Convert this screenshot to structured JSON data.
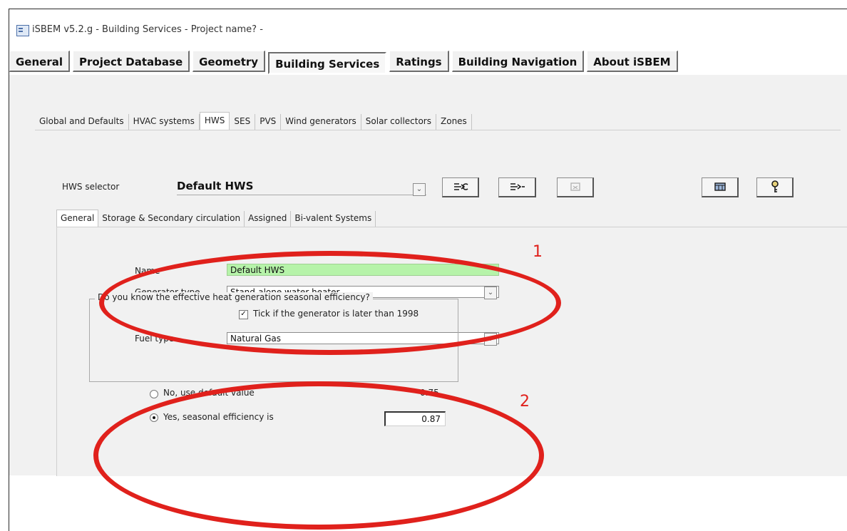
{
  "window": {
    "title": "iSBEM v5.2.g - Building Services - Project name? -"
  },
  "main_tabs": [
    {
      "label": "General"
    },
    {
      "label": "Project Database"
    },
    {
      "label": "Geometry"
    },
    {
      "label": "Building Services",
      "active": true
    },
    {
      "label": "Ratings"
    },
    {
      "label": "Building Navigation"
    },
    {
      "label": "About iSBEM"
    }
  ],
  "sub_tabs": [
    {
      "label": "Global and Defaults"
    },
    {
      "label": "HVAC systems"
    },
    {
      "label": "HWS",
      "active": true
    },
    {
      "label": "SES"
    },
    {
      "label": "PVS"
    },
    {
      "label": "Wind generators"
    },
    {
      "label": "Solar collectors"
    },
    {
      "label": "Zones"
    }
  ],
  "selector": {
    "label": "HWS selector",
    "value": "Default HWS"
  },
  "toolbar": {
    "copy_icon": "copy-icon",
    "add_icon": "add-icon",
    "delete_icon": "delete-icon",
    "table_icon": "table-icon",
    "help_icon": "help-key-icon"
  },
  "general_tabs": [
    {
      "label": "General",
      "active": true
    },
    {
      "label": "Storage & Secondary circulation"
    },
    {
      "label": "Assigned"
    },
    {
      "label": "Bi-valent Systems"
    }
  ],
  "form": {
    "name_label": "Name",
    "name_value": "Default HWS",
    "generator_label": "Generator type",
    "generator_value": "Stand-alone water heater",
    "later_than_1998_label": "Tick if the generator is later than 1998",
    "later_than_1998_checked": true,
    "fuel_label": "Fuel type",
    "fuel_value": "Natural Gas",
    "efficiency_question": "Do you know the effective heat generation seasonal efficiency?",
    "no_option_label": "No, use default value",
    "default_value": "0.75",
    "yes_option_label": "Yes, seasonal efficiency is",
    "seasonal_efficiency_value": "0.87",
    "selected_option": "yes"
  },
  "annotations": [
    {
      "label": "1",
      "color": "#e0211c"
    },
    {
      "label": "2",
      "color": "#e0211c"
    }
  ],
  "colors": {
    "panel": "#f1f1f1",
    "name_field": "#b6f3a9",
    "annotation": "#e0211c"
  }
}
